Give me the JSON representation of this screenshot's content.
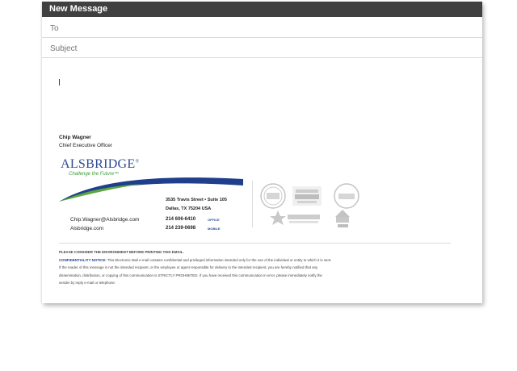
{
  "window": {
    "title": "New Message"
  },
  "fields": {
    "to_placeholder": "To",
    "subject_placeholder": "Subject"
  },
  "signature": {
    "name": "Chip Wagner",
    "title": "Chief Executive Officer",
    "logo_text": "ALSBRIDGE",
    "logo_reg": "®",
    "tagline": "Challenge the Future™",
    "address_line1": "3535 Travis Street • Suite 105",
    "address_line2": "Dallas, TX 75204  USA",
    "email": "Chip.Wagner@Alsbridge.com",
    "website": "Alsbridge.com",
    "phone_office": "214 606-6410",
    "phone_office_label": "OFFICE",
    "phone_mobile": "214 239-0698",
    "phone_mobile_label": "MOBILE",
    "badges": [
      "Inc. 500",
      "2010-14 World's Best Outsourcing Advisors",
      "Best Places to Work",
      "Troops First Foundation",
      "Grace"
    ]
  },
  "notice": {
    "environment": "PLEASE CONSIDER THE ENVIRONMENT BEFORE PRINTING THIS EMAIL.",
    "conf_label": "CONFIDENTIALITY NOTICE:",
    "conf_text": " This Electronic Mail e-mail contains confidential and privileged information intended only for the use of the individual or entity to which it is sent.",
    "line2": "If the reader of this message is not the intended recipient, or the employee or agent responsible for delivery to the intended recipient, you are hereby notified that any",
    "line3": "dissemination, distribution, or copying of this communication is STRICTLY PROHIBITED. If you have received this communication in error, please immediately notify the",
    "line4": "sender by reply e-mail or telephone."
  },
  "colors": {
    "titlebar": "#404040",
    "brand_blue": "#2a4a93",
    "brand_green": "#3d9b3c"
  }
}
